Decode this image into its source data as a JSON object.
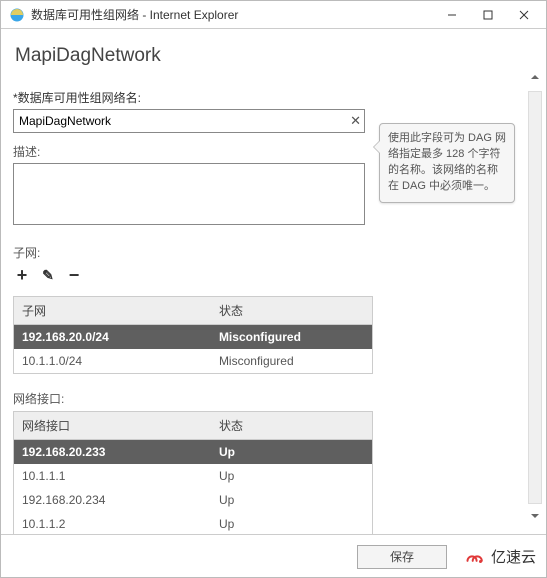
{
  "window": {
    "title": "数据库可用性组网络 - Internet Explorer"
  },
  "page": {
    "heading": "MapiDagNetwork"
  },
  "fields": {
    "name_label": "*数据库可用性组网络名:",
    "name_value": "MapiDagNetwork",
    "desc_label": "描述:",
    "desc_value": "",
    "subnet_label": "子网:",
    "iface_label": "网络接口:"
  },
  "tooltip": {
    "text": "使用此字段可为 DAG 网络指定最多 128 个字符的名称。该网络的名称在 DAG 中必须唯一。"
  },
  "subnet_table": {
    "col1": "子网",
    "col2": "状态",
    "rows": [
      {
        "c1": "192.168.20.0/24",
        "c2": "Misconfigured",
        "selected": true
      },
      {
        "c1": "10.1.1.0/24",
        "c2": "Misconfigured",
        "selected": false
      }
    ]
  },
  "iface_table": {
    "col1": "网络接口",
    "col2": "状态",
    "rows": [
      {
        "c1": "192.168.20.233",
        "c2": "Up",
        "selected": true
      },
      {
        "c1": "10.1.1.1",
        "c2": "Up",
        "selected": false
      },
      {
        "c1": "192.168.20.234",
        "c2": "Up",
        "selected": false
      },
      {
        "c1": "10.1.1.2",
        "c2": "Up",
        "selected": false
      }
    ]
  },
  "toolbar": {
    "add": "+",
    "edit": "✎",
    "remove": "−"
  },
  "footer": {
    "save": "保存",
    "brand": "亿速云"
  }
}
